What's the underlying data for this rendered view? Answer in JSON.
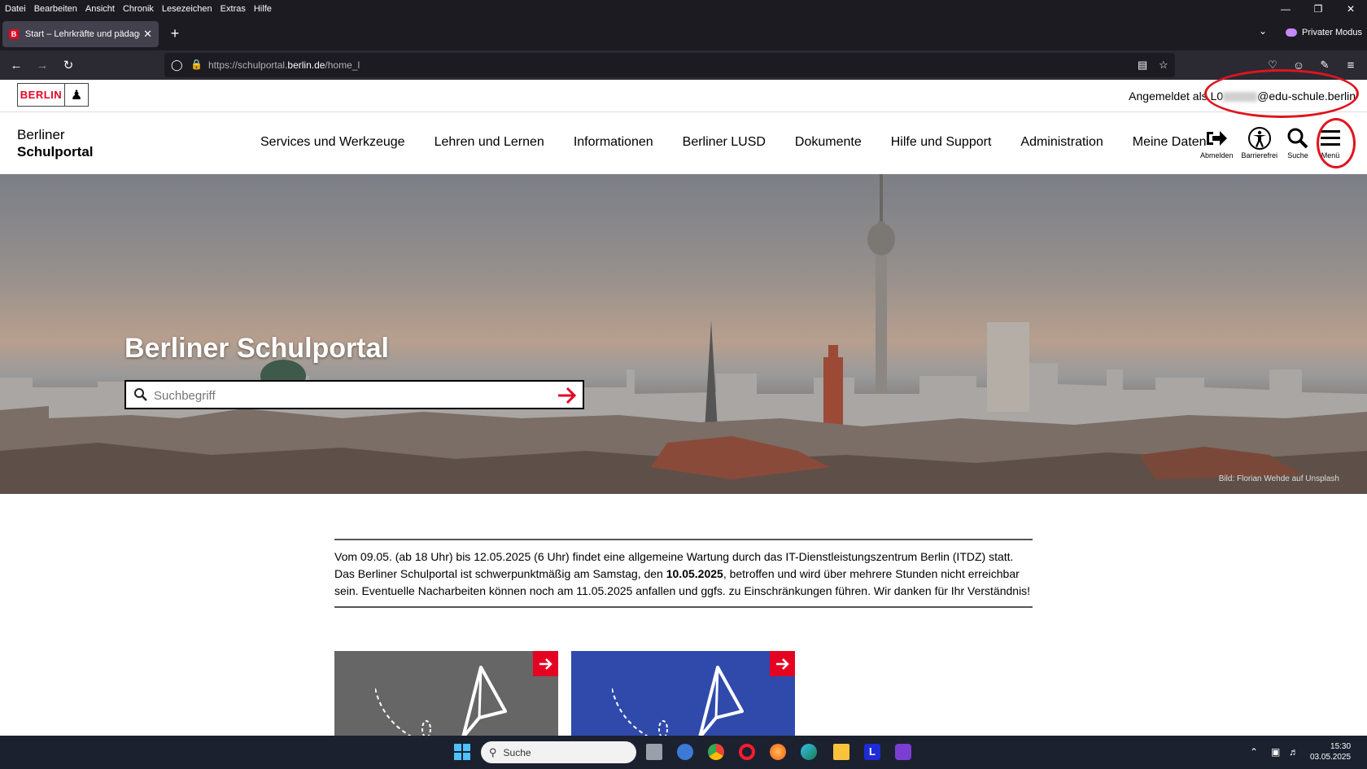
{
  "browser": {
    "menu": [
      "Datei",
      "Bearbeiten",
      "Ansicht",
      "Chronik",
      "Lesezeichen",
      "Extras",
      "Hilfe"
    ],
    "tab_title": "Start – Lehrkräfte und pädagog",
    "url_prefix": "https://schulportal.",
    "url_domain": "berlin.de",
    "url_suffix": "/home_l",
    "private_mode": "Privater Modus"
  },
  "page": {
    "logo_text": "BERLIN",
    "logged_in_prefix": "Angemeldet als",
    "user_start": "L0",
    "user_end": "@edu-schule.berlin",
    "site_title_line1": "Berliner",
    "site_title_line2": "Schulportal",
    "nav": [
      "Services und Werkzeuge",
      "Lehren und Lernen",
      "Informationen",
      "Berliner LUSD",
      "Dokumente",
      "Hilfe und Support",
      "Administration",
      "Meine Daten"
    ],
    "tools": {
      "logout": "Abmelden",
      "accessibility": "Barrierefrei",
      "search": "Suche",
      "menu": "Menü"
    },
    "hero_title": "Berliner Schulportal",
    "search_placeholder": "Suchbegriff",
    "photo_credit": "Bild: Florian Wehde auf Unsplash",
    "notice": {
      "part1": "Vom 09.05. (ab 18 Uhr) bis 12.05.2025 (6 Uhr) findet eine allgemeine Wartung durch das IT-Dienstleistungszentrum Berlin (ITDZ) statt. Das Berliner Schulportal ist schwerpunktmäßig am Samstag, den ",
      "bold": "10.05.2025",
      "part2": ", betroffen und wird über mehrere Stunden nicht erreichbar sein. Eventuelle Nacharbeiten können noch am 11.05.2025 anfallen und ggfs. zu Einschränkungen führen. Wir danken für Ihr Verständnis!"
    }
  },
  "taskbar": {
    "search": "Suche",
    "time": "15:30",
    "date": "03.05.2025"
  },
  "colors": {
    "berlin_red": "#e40422",
    "card_blue": "#2f4aab",
    "card_gray": "#666666",
    "annotation_red": "#e0141e"
  }
}
